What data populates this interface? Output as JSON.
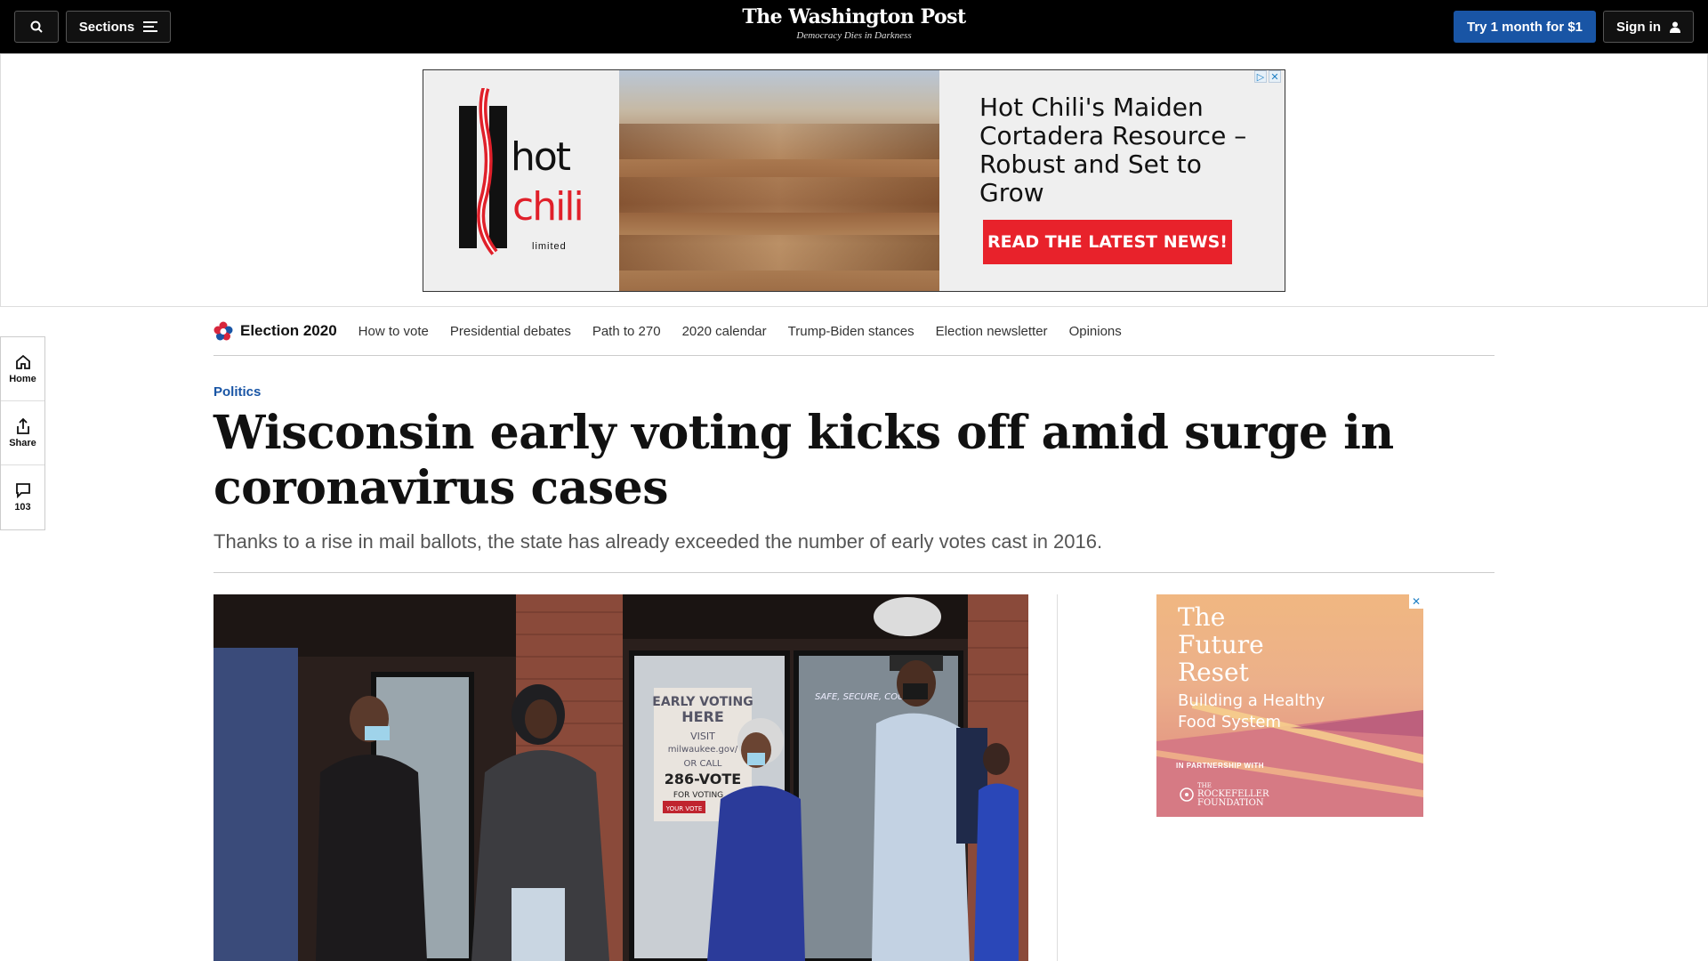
{
  "header": {
    "sections_label": "Sections",
    "logo": "The Washington Post",
    "tagline": "Democracy Dies in Darkness",
    "try_label": "Try 1 month for $1",
    "signin_label": "Sign in"
  },
  "top_ad": {
    "logo_text_1": "hot",
    "logo_text_2": "chili",
    "logo_text_3": "limited",
    "headline": "Hot Chili's Maiden Cortadera Resource – Robust and Set to Grow",
    "cta": "READ THE LATEST NEWS!"
  },
  "election_nav": {
    "brand": "Election 2020",
    "links": [
      "How to vote",
      "Presidential debates",
      "Path to 270",
      "2020 calendar",
      "Trump-Biden stances",
      "Election newsletter",
      "Opinions"
    ]
  },
  "rail": {
    "home_label": "Home",
    "share_label": "Share",
    "comments_count": "103"
  },
  "article": {
    "kicker": "Politics",
    "headline": "Wisconsin early voting kicks off amid surge in coronavirus cases",
    "dek": "Thanks to a rise in mail ballots, the state has already exceeded the number of early votes cast in 2016."
  },
  "photo": {
    "sign_1": "EARLY VOTING",
    "sign_2": "HERE",
    "sign_3": "VISIT",
    "sign_4": "milwaukee.gov/",
    "sign_5": "OR CALL",
    "sign_6": "286-VOTE",
    "sign_7": "FOR VOTING",
    "sign_8": "YOUR VOTE",
    "window_text": "SAFE, SECURE, COUNTED"
  },
  "side_ad": {
    "title_1": "The",
    "title_2": "Future",
    "title_3": "Reset",
    "subtitle_1": "Building a Healthy",
    "subtitle_2": "Food System",
    "partner": "IN PARTNERSHIP WITH",
    "foundation_1": "THE",
    "foundation_2": "ROCKEFELLER",
    "foundation_3": "FOUNDATION"
  }
}
